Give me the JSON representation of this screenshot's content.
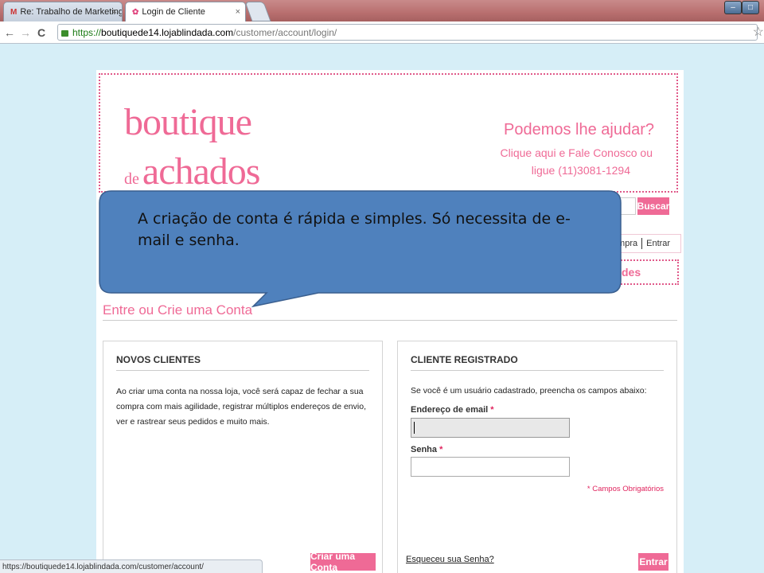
{
  "browser": {
    "tabs": [
      {
        "label": "Re: Trabalho de Marketing",
        "close": "×",
        "favicon": "M"
      },
      {
        "label": "Login de Cliente",
        "close": "×",
        "favicon": "✿"
      }
    ],
    "window_buttons": {
      "minimize": "–",
      "maximize": "□"
    },
    "nav": {
      "back": "←",
      "forward": "→",
      "reload": "C"
    },
    "url": {
      "scheme": "https://",
      "host": "boutiquede14.lojablindada.com",
      "path": "/customer/account/login/"
    },
    "bookmark_icon": "☆"
  },
  "header": {
    "logo_line1": "boutique",
    "logo_de": "de",
    "logo_line2": "achados",
    "help_title": "Podemos lhe ajudar?",
    "help_line1": "Clique aqui e Fale Conosco ou",
    "help_line2": "ligue (11)3081-1294",
    "search_button": "Buscar",
    "account_links": {
      "compra": "Compra",
      "entrar": "Entrar"
    },
    "nav_fragment": "des"
  },
  "callout": {
    "text": "A criação de conta é rápida e simples. Só necessita de e-mail e senha.",
    "fill": "#4f81bd",
    "stroke": "#3a5f8f"
  },
  "page": {
    "title": "Entre ou Crie uma Conta",
    "new_customers": {
      "heading": "NOVOS CLIENTES",
      "description": "Ao criar uma conta na nossa loja, você será capaz de fechar a sua compra com mais agilidade, registrar múltiplos endereços de envio, ver e rastrear seus pedidos e muito mais.",
      "button": "Criar uma Conta"
    },
    "registered": {
      "heading": "CLIENTE REGISTRADO",
      "description": "Se você é um usuário cadastrado, preencha os campos abaixo:",
      "email_label": "Endereço de email",
      "password_label": "Senha",
      "required_mark": "*",
      "required_note": "* Campos Obrigatórios",
      "forgot": "Esqueceu sua Senha?",
      "button": "Entrar"
    }
  },
  "status_bar": "https://boutiquede14.lojablindada.com/customer/account/",
  "colors": {
    "accent_pink": "#ef6a96",
    "page_background": "#d6eef7"
  }
}
